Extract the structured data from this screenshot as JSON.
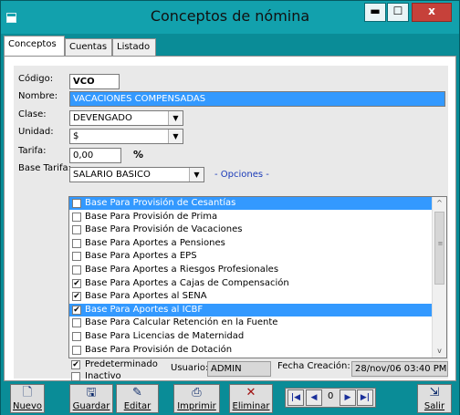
{
  "window": {
    "title": "Conceptos de nómina",
    "controls": {
      "minimize": "▬",
      "maximize": "☐",
      "close": "x"
    }
  },
  "tabs": [
    {
      "label": "Conceptos"
    },
    {
      "label": "Cuentas"
    },
    {
      "label": "Listado"
    }
  ],
  "form": {
    "codigo": {
      "label": "Código:",
      "value": "VCO"
    },
    "nombre": {
      "label": "Nombre:",
      "value": "VACACIONES COMPENSADAS"
    },
    "clase": {
      "label": "Clase:",
      "value": "DEVENGADO"
    },
    "unidad": {
      "label": "Unidad:",
      "value": "$"
    },
    "tarifa": {
      "label": "Tarifa:",
      "value": "0,00",
      "suffix": "%"
    },
    "base_tarifa": {
      "label": "Base Tarifa:",
      "value": "SALARIO BASICO"
    },
    "opciones_link": "- Opciones -"
  },
  "options_list": [
    {
      "label": "Base Para Provisión de Cesantías",
      "checked": false,
      "highlighted": true
    },
    {
      "label": "Base Para Provisión de Prima",
      "checked": false,
      "highlighted": false
    },
    {
      "label": "Base Para Provisión de Vacaciones",
      "checked": false,
      "highlighted": false
    },
    {
      "label": "Base Para Aportes a Pensiones",
      "checked": false,
      "highlighted": false
    },
    {
      "label": "Base Para Aportes a EPS",
      "checked": false,
      "highlighted": false
    },
    {
      "label": "Base Para Aportes a Riesgos Profesionales",
      "checked": false,
      "highlighted": false
    },
    {
      "label": "Base Para Aportes a Cajas de Compensación",
      "checked": true,
      "highlighted": false
    },
    {
      "label": "Base Para Aportes al SENA",
      "checked": true,
      "highlighted": false
    },
    {
      "label": "Base Para Aportes al ICBF",
      "checked": true,
      "highlighted": true
    },
    {
      "label": "Base Para Calcular Retención en la Fuente",
      "checked": false,
      "highlighted": false
    },
    {
      "label": "Base Para Licencias de Maternidad",
      "checked": false,
      "highlighted": false
    },
    {
      "label": "Base Para Provisión de Dotación",
      "checked": false,
      "highlighted": false
    }
  ],
  "footer": {
    "predeterminado": {
      "label": "Predeterminado",
      "checked": true
    },
    "inactivo": {
      "label": "Inactivo",
      "checked": false
    },
    "usuario_label": "Usuario:",
    "usuario_value": "ADMIN",
    "fecha_label": "Fecha Creación:",
    "fecha_value": "28/nov/06 03:40 PM"
  },
  "toolbar": {
    "nuevo": "Nuevo",
    "guardar": "Guardar",
    "editar": "Editar",
    "imprimir": "Imprimir",
    "eliminar": "Eliminar",
    "record_number": "0",
    "salir": "Salir"
  },
  "icons": {
    "check": "✔",
    "dropdown": "▼",
    "scroll_up": "^",
    "scroll_down": "v",
    "scroll_grip": "≡",
    "first": "|◀",
    "prev": "◀",
    "next": "▶",
    "last": "▶|"
  },
  "colors": {
    "window_frame": "#0a8c97",
    "titlebar": "#12a1ad",
    "selection": "#3399ff",
    "close_button": "#c6413a",
    "form_background": "#e9e9e9"
  }
}
